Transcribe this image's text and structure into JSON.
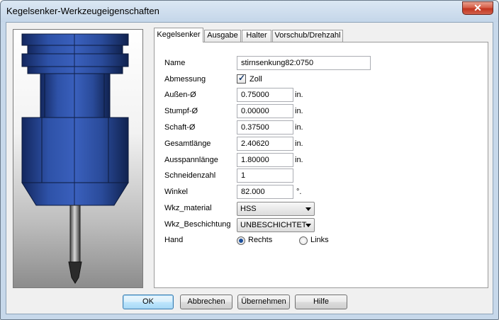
{
  "window": {
    "title": "Kegelsenker-Werkzeugeigenschaften"
  },
  "tabs": [
    "Kegelsenker",
    "Ausgabe",
    "Halter",
    "Vorschub/Drehzahl"
  ],
  "form": {
    "name": {
      "label": "Name",
      "value": "stirnsenkung82:0750"
    },
    "abmessung": {
      "label": "Abmessung",
      "checkbox_label": "Zoll",
      "checked": true
    },
    "aussen": {
      "label": "Außen-Ø",
      "value": "0.75000",
      "unit": "in."
    },
    "stumpf": {
      "label": "Stumpf-Ø",
      "value": "0.00000",
      "unit": "in."
    },
    "schaft": {
      "label": "Schaft-Ø",
      "value": "0.37500",
      "unit": "in."
    },
    "gesamt": {
      "label": "Gesamtlänge",
      "value": "2.40620",
      "unit": "in."
    },
    "ausspann": {
      "label": "Ausspannlänge",
      "value": "1.80000",
      "unit": "in."
    },
    "schneiden": {
      "label": "Schneidenzahl",
      "value": "1"
    },
    "winkel": {
      "label": "Winkel",
      "value": "82.000",
      "unit": "°."
    },
    "material": {
      "label": "Wkz_material",
      "value": "HSS"
    },
    "beschichtung": {
      "label": "Wkz_Beschichtung",
      "value": "UNBESCHICHTET"
    },
    "hand": {
      "label": "Hand",
      "option_right": "Rechts",
      "option_left": "Links",
      "selected": "Rechts"
    }
  },
  "buttons": {
    "ok": "OK",
    "cancel": "Abbrechen",
    "apply": "Übernehmen",
    "help": "Hilfe"
  },
  "icons": {
    "close": "close-icon",
    "check": "check-icon",
    "dropdown": "chevron-down-icon"
  },
  "colors": {
    "tool_body": "#2a4b9a",
    "accent": "#3c7fb1",
    "close_button": "#c2351f"
  }
}
